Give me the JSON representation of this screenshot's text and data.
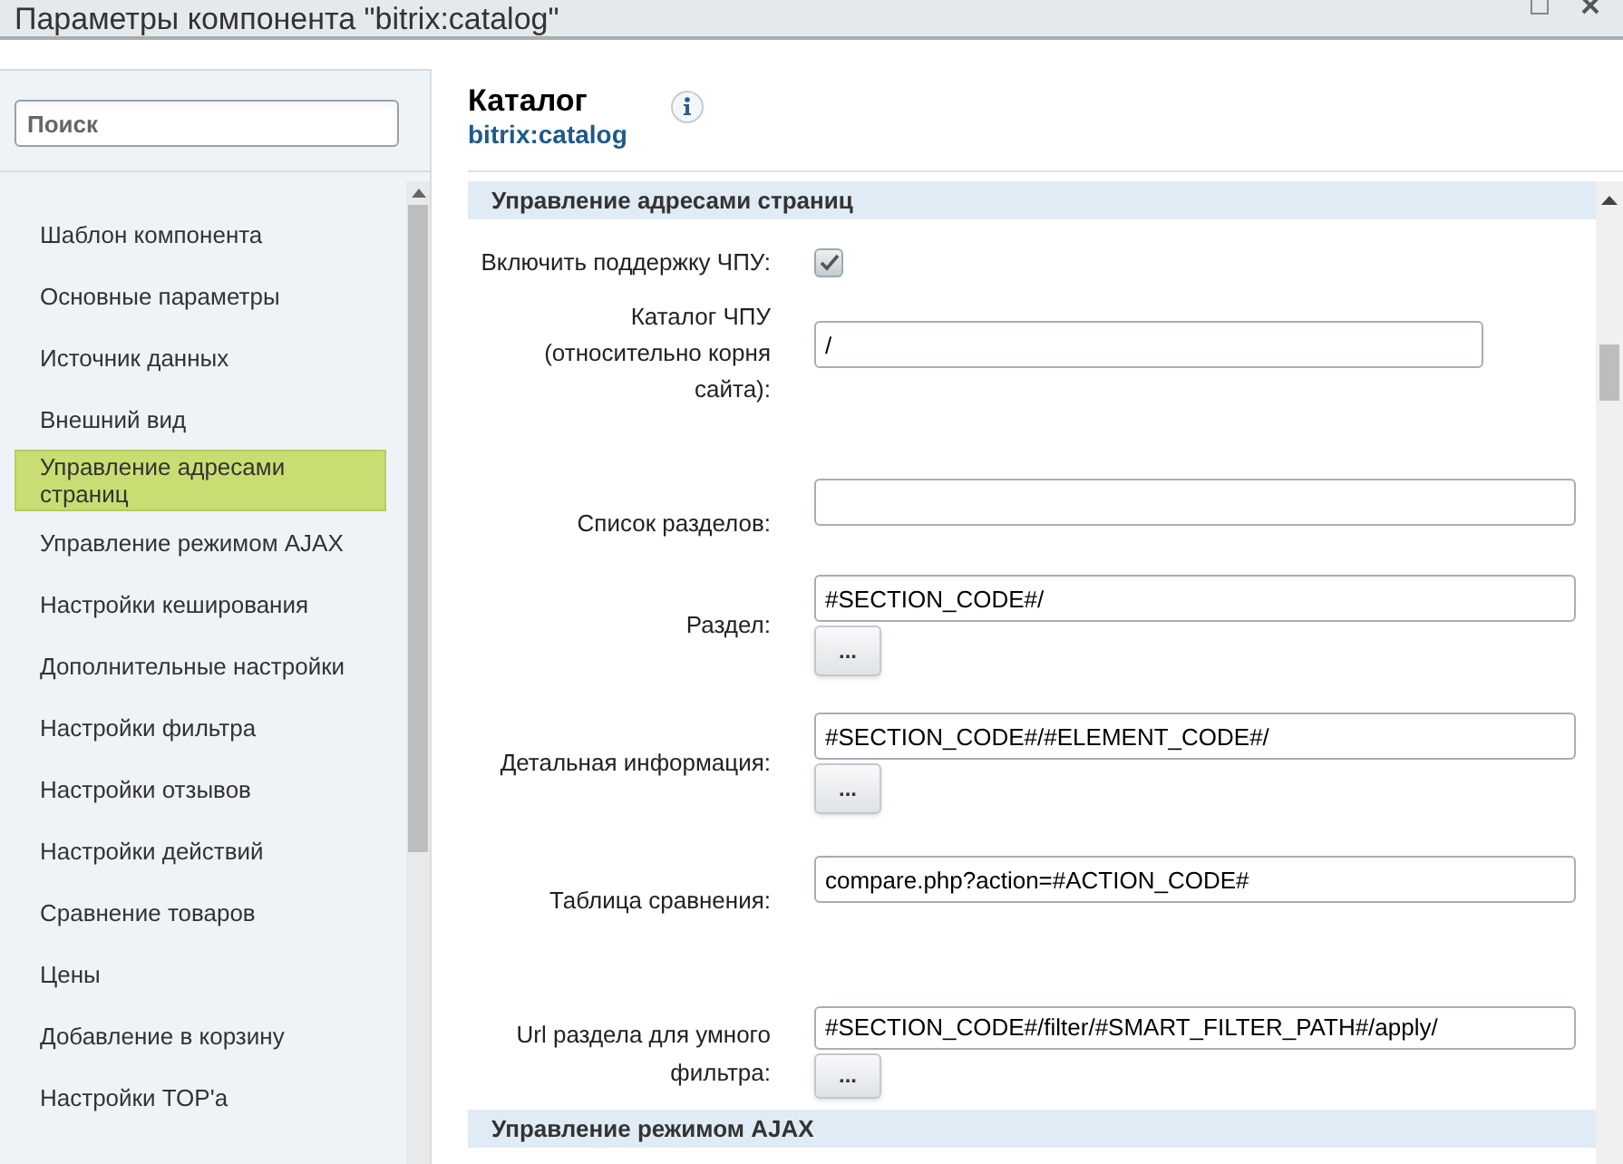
{
  "window": {
    "title": "Параметры компонента \"bitrix:catalog\""
  },
  "sidebar": {
    "search": {
      "placeholder": "Поиск"
    },
    "items": [
      {
        "label": "Шаблон компонента",
        "selected": false
      },
      {
        "label": "Основные параметры",
        "selected": false
      },
      {
        "label": "Источник данных",
        "selected": false
      },
      {
        "label": "Внешний вид",
        "selected": false
      },
      {
        "label": "Управление адресами страниц",
        "selected": true
      },
      {
        "label": "Управление режимом AJAX",
        "selected": false
      },
      {
        "label": "Настройки кеширования",
        "selected": false
      },
      {
        "label": "Дополнительные настройки",
        "selected": false
      },
      {
        "label": "Настройки фильтра",
        "selected": false
      },
      {
        "label": "Настройки отзывов",
        "selected": false
      },
      {
        "label": "Настройки действий",
        "selected": false
      },
      {
        "label": "Сравнение товаров",
        "selected": false
      },
      {
        "label": "Цены",
        "selected": false
      },
      {
        "label": "Добавление в корзину",
        "selected": false
      },
      {
        "label": "Настройки TOP'а",
        "selected": false
      }
    ]
  },
  "header": {
    "title": "Каталог",
    "subtitle": "bitrix:catalog"
  },
  "sections": [
    {
      "title": "Управление адресами страниц",
      "fields": [
        {
          "kind": "checkbox",
          "label": "Включить поддержку ЧПУ:",
          "checked": true
        },
        {
          "kind": "short_text",
          "label": "Каталог ЧПУ (относительно корня сайта):",
          "value": "/"
        },
        {
          "kind": "text",
          "label": "Список разделов:"
        },
        {
          "kind": "text",
          "label": "Раздел:",
          "value": "#SECTION_CODE#/",
          "button": "..."
        },
        {
          "kind": "text",
          "label": "Детальная информация:",
          "value": "#SECTION_CODE#/#ELEMENT_CODE#/",
          "button": "..."
        },
        {
          "kind": "text",
          "label": "Таблица сравнения:",
          "value": "compare.php?action=#ACTION_CODE#"
        },
        {
          "kind": "text",
          "label": "Url раздела для умного фильтра:",
          "value": "#SECTION_CODE#/filter/#SMART_FILTER_PATH#/apply/",
          "button": "..."
        }
      ]
    },
    {
      "title": "Управление режимом AJAX"
    }
  ]
}
